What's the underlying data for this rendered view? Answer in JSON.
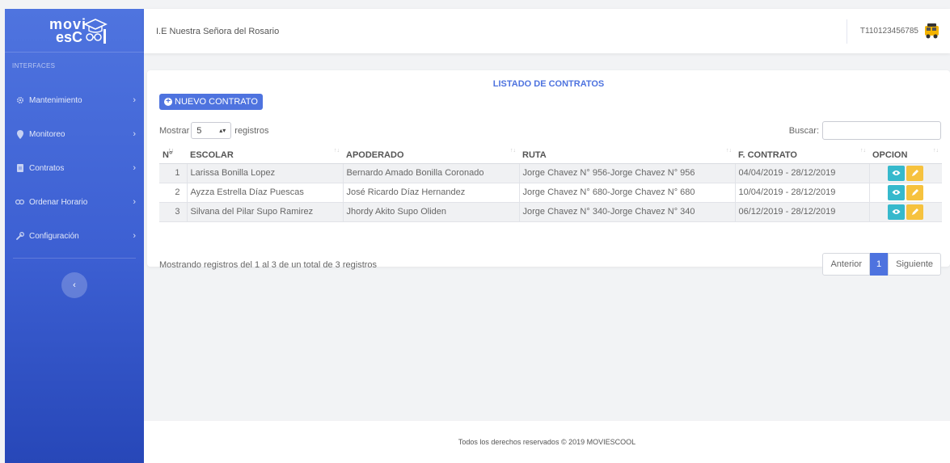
{
  "brand": {
    "line1": "movi",
    "line2": "esC"
  },
  "sidebar": {
    "section": "INTERFACES",
    "items": [
      {
        "label": "Mantenimiento",
        "icon": "gear-icon"
      },
      {
        "label": "Monitoreo",
        "icon": "map-marker-icon"
      },
      {
        "label": "Contratos",
        "icon": "document-icon"
      },
      {
        "label": "Ordenar Horario",
        "icon": "link-icon"
      },
      {
        "label": "Configuración",
        "icon": "wrench-icon"
      }
    ],
    "toggle_icon": "chevron-left-icon"
  },
  "topbar": {
    "school": "I.E Nuestra Señora del Rosario",
    "user_id": "T110123456785"
  },
  "main": {
    "title": "LISTADO DE CONTRATOS",
    "new_button": "NUEVO CONTRATO",
    "length": {
      "prefix": "Mostrar",
      "value": "5",
      "suffix": "registros"
    },
    "search_label": "Buscar:",
    "columns": [
      "N°",
      "ESCOLAR",
      "APODERADO",
      "RUTA",
      "F. CONTRATO",
      "OPCION"
    ],
    "rows": [
      {
        "n": "1",
        "escolar": "Larissa Bonilla Lopez",
        "apoderado": "Bernardo Amado Bonilla Coronado",
        "ruta": "Jorge Chavez N° 956-Jorge Chavez N° 956",
        "fecha": "04/04/2019 - 28/12/2019"
      },
      {
        "n": "2",
        "escolar": "Ayzza Estrella Díaz Puescas",
        "apoderado": "José Ricardo Díaz Hernandez",
        "ruta": "Jorge Chavez N° 680-Jorge Chavez N° 680",
        "fecha": "10/04/2019 - 28/12/2019"
      },
      {
        "n": "3",
        "escolar": "Silvana del Pilar Supo Ramirez",
        "apoderado": "Jhordy Akito Supo Oliden",
        "ruta": "Jorge Chavez N° 340-Jorge Chavez N° 340",
        "fecha": "06/12/2019 - 28/12/2019"
      }
    ],
    "info": "Mostrando registros del 1 al 3 de un total de 3 registros",
    "pagination": {
      "prev": "Anterior",
      "current": "1",
      "next": "Siguiente"
    }
  },
  "footer": {
    "text": "Todos los derechos reservados © 2019 MOVIESCOOL"
  },
  "colors": {
    "primary": "#4e73df",
    "info": "#36b9cc",
    "warning": "#f6c23e"
  }
}
